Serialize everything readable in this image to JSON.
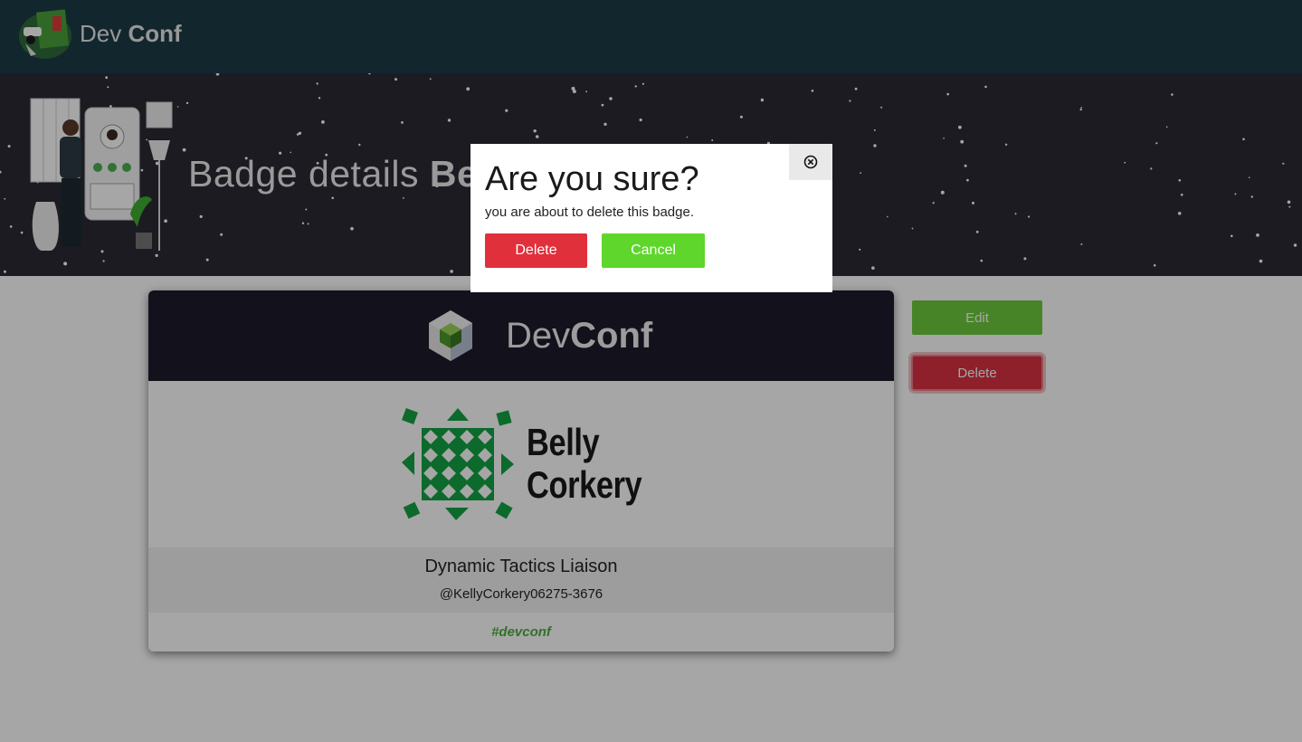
{
  "navbar": {
    "brand_part1": "Dev",
    "brand_part2": "Conf",
    "logo_icon": "devconf-logo-icon"
  },
  "hero": {
    "title_prefix": "Badge details",
    "title_highlight": "Belly"
  },
  "badge": {
    "header_brand_part1": "Dev",
    "header_brand_part2": "Conf",
    "name_line1": "Belly",
    "name_line2": "Corkery",
    "job_title": "Dynamic Tactics Liaison",
    "handle": "@KellyCorkery06275-3676",
    "hashtag": "#devconf"
  },
  "actions": {
    "edit_label": "Edit",
    "delete_label": "Delete"
  },
  "modal": {
    "title": "Are you sure?",
    "message": "you are about to delete this badge.",
    "delete_label": "Delete",
    "cancel_label": "Cancel",
    "close_icon": "close-circle-icon"
  },
  "colors": {
    "navbar_bg": "#1d3b47",
    "hero_bg": "#2a2a33",
    "badge_header_bg": "#1c1b2b",
    "edit_green": "#6ccb3c",
    "danger_red": "#e0303c",
    "cancel_green": "#5fd62b",
    "hashtag_green": "#4cae3c"
  }
}
